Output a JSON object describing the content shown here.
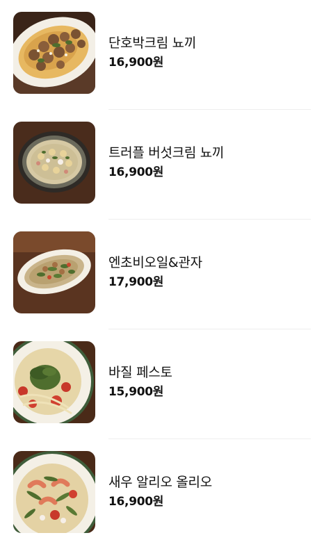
{
  "menu": {
    "items": [
      {
        "name": "단호박크림 뇨끼",
        "price": "16,900원",
        "image": "pumpkin-cream-gnocchi-photo"
      },
      {
        "name": "트러플 버섯크림 뇨끼",
        "price": "16,900원",
        "image": "truffle-mushroom-cream-gnocchi-photo"
      },
      {
        "name": "엔초비오일&관자",
        "price": "17,900원",
        "image": "anchovy-oil-scallop-pasta-photo"
      },
      {
        "name": "바질 페스토",
        "price": "15,900원",
        "image": "basil-pesto-pasta-photo"
      },
      {
        "name": "새우 알리오 올리오",
        "price": "16,900원",
        "image": "shrimp-aglio-olio-photo"
      }
    ]
  }
}
